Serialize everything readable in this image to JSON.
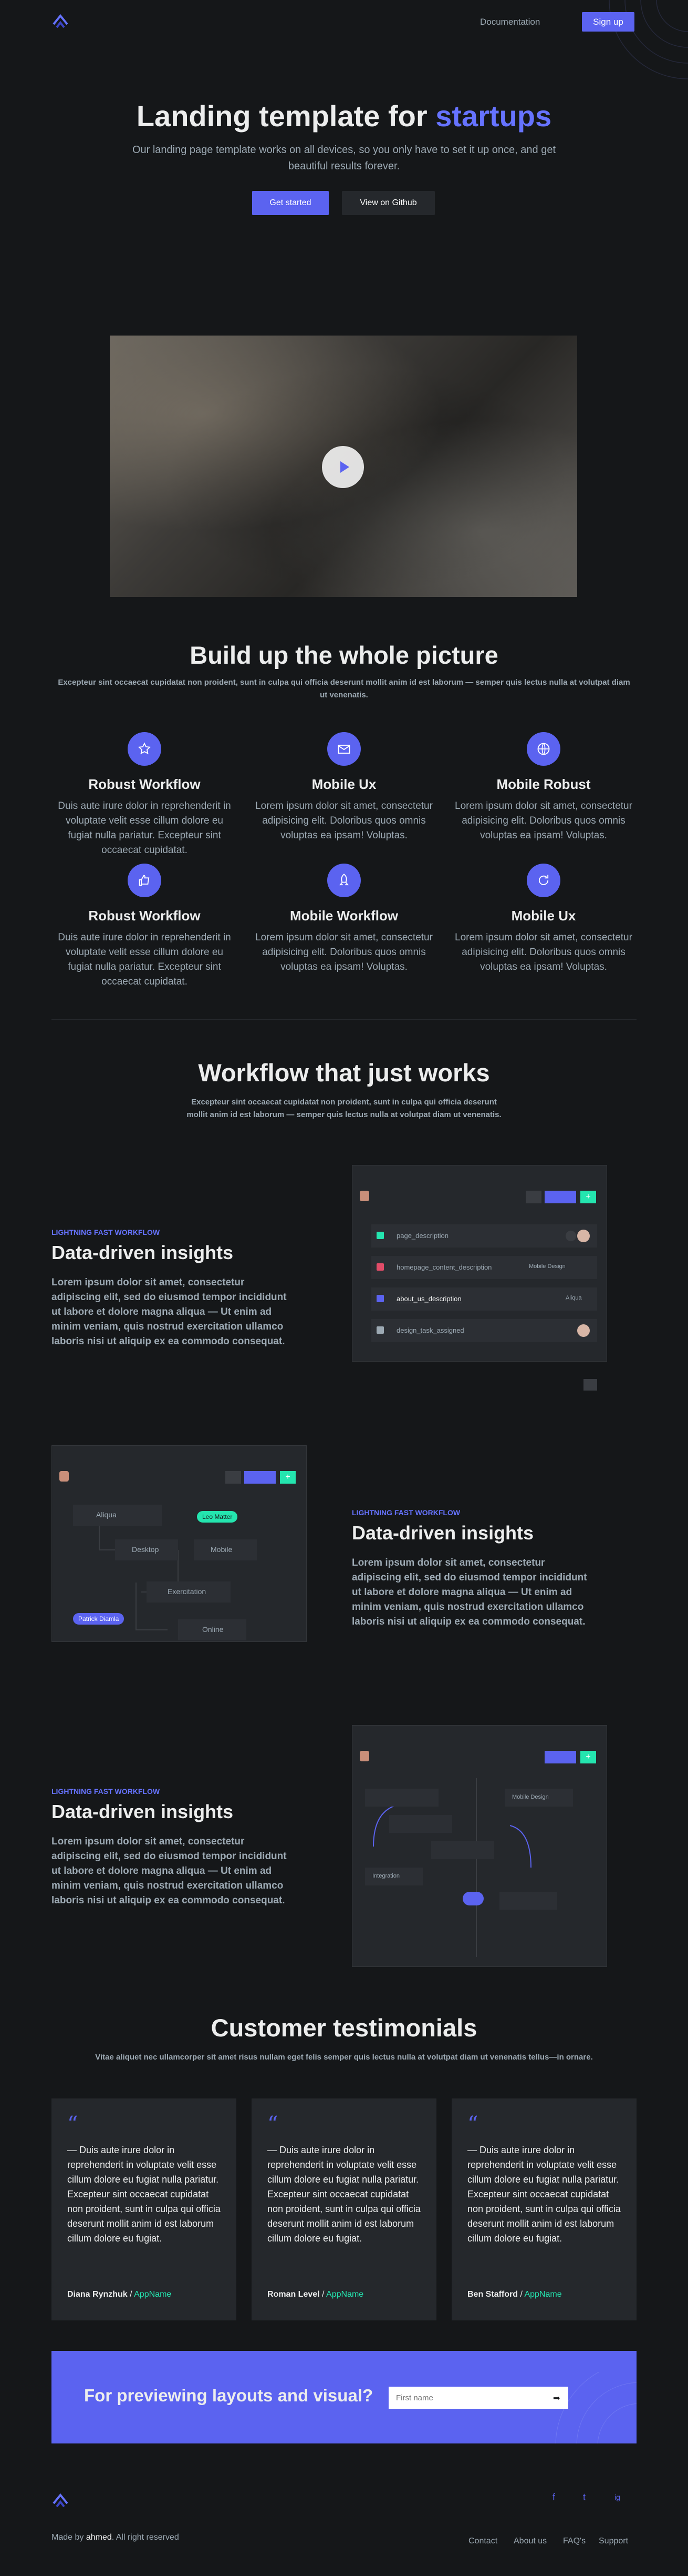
{
  "header": {
    "nav_link": "Documentation",
    "signup": "Sign up"
  },
  "hero": {
    "title_main": "Landing template for ",
    "title_accent": "startups",
    "subtitle": "Our landing page template works on all devices, so you only have to set it up once, and get beautiful results forever.",
    "cta_primary": "Get started",
    "cta_secondary": "View on Github"
  },
  "features": {
    "title": "Build up the whole picture",
    "subtitle": "Excepteur sint occaecat cupidatat non proident, sunt in culpa qui officia deserunt mollit anim id est laborum — semper quis lectus nulla at volutpat diam ut venenatis.",
    "items": [
      {
        "title": "Robust Workflow",
        "text": "Duis aute irure dolor in reprehenderit in voluptate velit esse cillum dolore eu fugiat nulla pariatur. Excepteur sint occaecat cupidatat.",
        "icon": "star-icon"
      },
      {
        "title": "Mobile Ux",
        "text": "Lorem ipsum dolor sit amet, consectetur adipisicing elit. Doloribus quos omnis voluptas ea ipsam! Voluptas.",
        "icon": "mail-icon"
      },
      {
        "title": "Mobile Robust",
        "text": "Lorem ipsum dolor sit amet, consectetur adipisicing elit. Doloribus quos omnis voluptas ea ipsam! Voluptas.",
        "icon": "globe-icon"
      },
      {
        "title": "Robust Workflow",
        "text": "Duis aute irure dolor in reprehenderit in voluptate velit esse cillum dolore eu fugiat nulla pariatur. Excepteur sint occaecat cupidatat.",
        "icon": "thumbs-up-icon"
      },
      {
        "title": "Mobile Workflow",
        "text": "Lorem ipsum dolor sit amet, consectetur adipisicing elit. Doloribus quos omnis voluptas ea ipsam! Voluptas.",
        "icon": "rocket-icon"
      },
      {
        "title": "Mobile Ux",
        "text": "Lorem ipsum dolor sit amet, consectetur adipisicing elit. Doloribus quos omnis voluptas ea ipsam! Voluptas.",
        "icon": "refresh-icon"
      }
    ]
  },
  "workflow": {
    "title": "Workflow that just works",
    "subtitle": "Excepteur sint occaecat cupidatat non proident, sunt in culpa qui officia deserunt mollit anim id est laborum — semper quis lectus nulla at volutpat diam ut venenatis.",
    "splits": [
      {
        "eyebrow": "LIGHTNING FAST WORKFLOW",
        "title": "Data-driven insights",
        "text": "Lorem ipsum dolor sit amet, consectetur adipiscing elit, sed do eiusmod tempor incididunt ut labore et dolore magna aliqua — Ut enim ad minim veniam, quis nostrud exercitation ullamco laboris nisi ut aliquip ex ea commodo consequat."
      },
      {
        "eyebrow": "LIGHTNING FAST WORKFLOW",
        "title": "Data-driven insights",
        "text": "Lorem ipsum dolor sit amet, consectetur adipiscing elit, sed do eiusmod tempor incididunt ut labore et dolore magna aliqua — Ut enim ad minim veniam, quis nostrud exercitation ullamco laboris nisi ut aliquip ex ea commodo consequat."
      },
      {
        "eyebrow": "LIGHTNING FAST WORKFLOW",
        "title": "Data-driven insights",
        "text": "Lorem ipsum dolor sit amet, consectetur adipiscing elit, sed do eiusmod tempor incididunt ut labore et dolore magna aliqua — Ut enim ad minim veniam, quis nostrud exercitation ullamco laboris nisi ut aliquip ex ea commodo consequat."
      }
    ],
    "mock1": {
      "rows": [
        "page_description",
        "homepage_content_description",
        "about_us_description",
        "design_task_assigned"
      ],
      "tags": [
        "Mobile Design",
        "Aliqua"
      ]
    },
    "mock2": {
      "nodes": [
        "Aliqua",
        "Desktop",
        "Mobile",
        "Exercitation",
        "Online"
      ],
      "pills": [
        "Leo Matter",
        "Patrick Diamla"
      ]
    },
    "mock3": {
      "labels": [
        "Mobile Design",
        "Integration"
      ]
    }
  },
  "testimonials": {
    "title": "Customer testimonials",
    "subtitle": "Vitae aliquet nec ullamcorper sit amet risus nullam eget felis semper quis lectus nulla at volutpat diam ut venenatis tellus—in ornare.",
    "items": [
      {
        "quote": "— Duis aute irure dolor in reprehenderit in voluptate velit esse cillum dolore eu fugiat nulla pariatur. Excepteur sint occaecat cupidatat non proident, sunt in culpa qui officia deserunt mollit anim id est laborum cillum dolore eu fugiat.",
        "name": "Diana Rynzhuk",
        "app": "AppName"
      },
      {
        "quote": "— Duis aute irure dolor in reprehenderit in voluptate velit esse cillum dolore eu fugiat nulla pariatur. Excepteur sint occaecat cupidatat non proident, sunt in culpa qui officia deserunt mollit anim id est laborum cillum dolore eu fugiat.",
        "name": "Roman Level",
        "app": "AppName"
      },
      {
        "quote": "— Duis aute irure dolor in reprehenderit in voluptate velit esse cillum dolore eu fugiat nulla pariatur. Excepteur sint occaecat cupidatat non proident, sunt in culpa qui officia deserunt mollit anim id est laborum cillum dolore eu fugiat.",
        "name": "Ben Stafford",
        "app": "AppName"
      }
    ]
  },
  "cta": {
    "title": "For previewing layouts and visual?",
    "placeholder": "First name"
  },
  "footer": {
    "made_by_prefix": "Made by ",
    "made_by_name": "ahmed",
    "made_by_suffix": ". All right reserved",
    "links": [
      "Contact",
      "About us",
      "FAQ's",
      "Support"
    ],
    "social": [
      "f",
      "t",
      "ig"
    ]
  },
  "colors": {
    "bg": "#151719",
    "accent": "#5b63f0",
    "green": "#24e5af",
    "card": "#25282c"
  }
}
